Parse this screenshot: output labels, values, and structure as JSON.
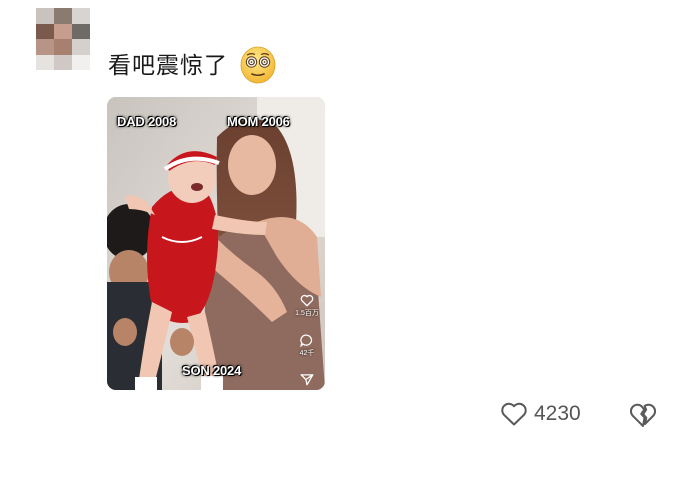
{
  "comment": {
    "text": "看吧震惊了",
    "emoji": "dizzy-eyes-emoji"
  },
  "video": {
    "labels": {
      "dad": "DAD 2008",
      "mom": "MOM 2006",
      "son": "SON 2024"
    },
    "side": {
      "likes": "1.5百万",
      "comments": "42千"
    }
  },
  "actions": {
    "like_count": "4230"
  }
}
